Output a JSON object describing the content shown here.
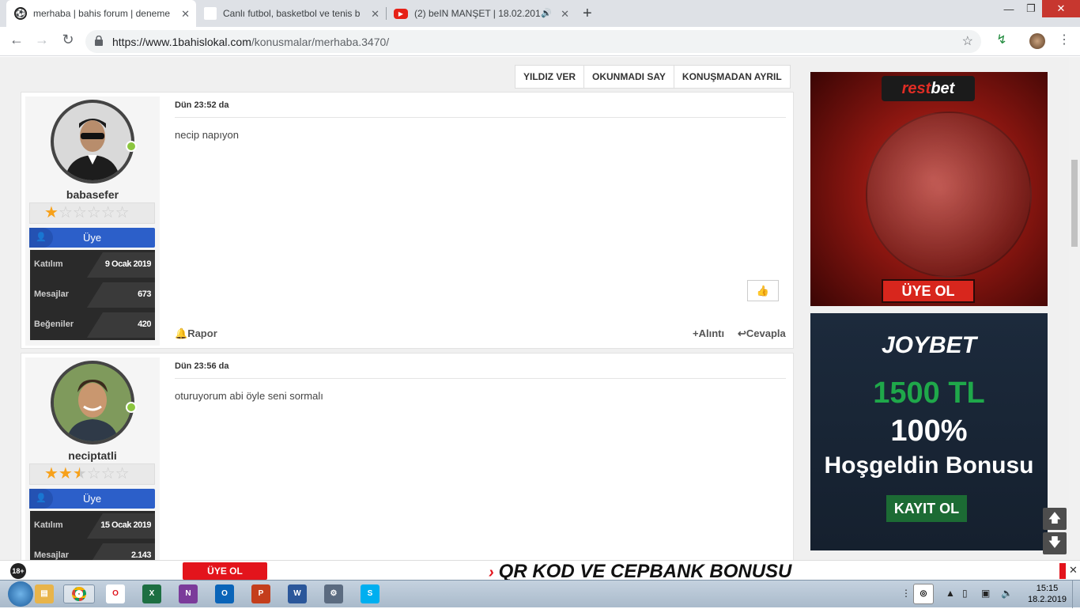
{
  "browser": {
    "tabs": [
      {
        "title": "merhaba | bahis forum | deneme",
        "active": true
      },
      {
        "title": "Canlı futbol, basketbol ve tenis b",
        "active": false
      },
      {
        "title": "(2) beIN MANŞET | 18.02.201",
        "active": false
      }
    ],
    "new_tab": "+",
    "url_host": "https://www.1bahislokal.com",
    "url_path": "/konusmalar/merhaba.3470/"
  },
  "thread_actions": [
    "YILDIZ VER",
    "OKUNMADI SAY",
    "KONUŞMADAN AYRIL"
  ],
  "posts": [
    {
      "username": "babasefer",
      "stars_filled": 1,
      "role": "Üye",
      "stats": [
        {
          "label": "Katılım",
          "value": "9 Ocak 2019"
        },
        {
          "label": "Mesajlar",
          "value": "673"
        },
        {
          "label": "Beğeniler",
          "value": "420"
        }
      ],
      "date": "Dün 23:52 da",
      "body": "necip napıyon",
      "report": "Rapor",
      "quote": "+Alıntı",
      "reply": "Cevapla"
    },
    {
      "username": "neciptatli",
      "stars_filled": 2.5,
      "role": "Üye",
      "stats": [
        {
          "label": "Katılım",
          "value": "15 Ocak 2019"
        },
        {
          "label": "Mesajlar",
          "value": "2.143"
        }
      ],
      "date": "Dün 23:56 da",
      "body": "oturuyorum abi öyle seni sormalı"
    }
  ],
  "ads": {
    "restbet": {
      "logo_a": "rest",
      "logo_b": "bet",
      "cta": "ÜYE OL"
    },
    "joybet": {
      "logo": "JOYBET",
      "amount": "1500 TL",
      "percent": "100%",
      "bonus": "Hoşgeldin Bonusu",
      "cta": "KAYIT OL"
    }
  },
  "banner": {
    "age": "18+",
    "cta": "ÜYE OL",
    "headline": "QR KOD VE CEPBANK BONUSU"
  },
  "taskbar": {
    "time": "15:15",
    "date": "18.2.2019"
  }
}
